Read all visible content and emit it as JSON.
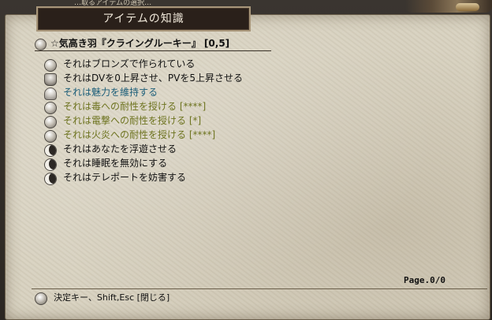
{
  "window": {
    "top_fringe_text": "…取るアイテムの選択…",
    "title": "アイテムの知識"
  },
  "item": {
    "heading": "☆気高き羽『クライングルーキー』 [0,5]",
    "properties": [
      {
        "icon": "circle-gem-icon",
        "color": "#111111",
        "text": "それはブロンズで作られている"
      },
      {
        "icon": "armor-icon",
        "color": "#111111",
        "text": "それはDVを0上昇させ、PVを5上昇させる"
      },
      {
        "icon": "figure-icon",
        "color": "#1d5f7a",
        "text": "それは魅力を維持する"
      },
      {
        "icon": "circle-gem-icon",
        "color": "#6e7420",
        "text": "それは毒への耐性を授ける [****]"
      },
      {
        "icon": "circle-gem-icon",
        "color": "#6e7420",
        "text": "それは電撃への耐性を授ける [*]"
      },
      {
        "icon": "circle-gem-icon",
        "color": "#6e7420",
        "text": "それは火炎への耐性を授ける [****]"
      },
      {
        "icon": "crescent-icon",
        "color": "#111111",
        "text": "それはあなたを浮遊させる"
      },
      {
        "icon": "crescent-icon",
        "color": "#111111",
        "text": "それは睡眠を無効にする"
      },
      {
        "icon": "crescent-icon",
        "color": "#111111",
        "text": "それはテレポートを妨害する"
      }
    ]
  },
  "pager": {
    "label": "Page.0/0"
  },
  "footer": {
    "hint": "決定キー、Shift,Esc [閉じる]"
  }
}
